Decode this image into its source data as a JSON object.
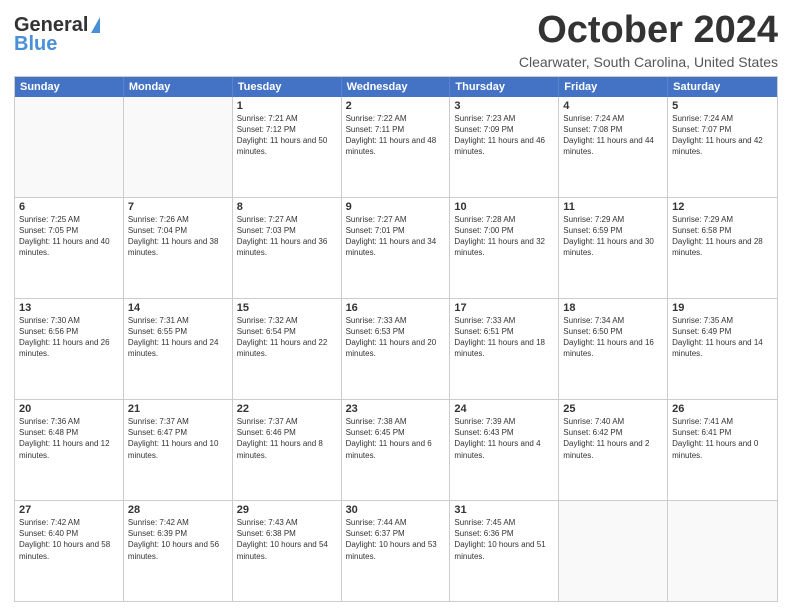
{
  "header": {
    "logo_line1": "General",
    "logo_line2": "Blue",
    "month_title": "October 2024",
    "location": "Clearwater, South Carolina, United States"
  },
  "days_of_week": [
    "Sunday",
    "Monday",
    "Tuesday",
    "Wednesday",
    "Thursday",
    "Friday",
    "Saturday"
  ],
  "weeks": [
    [
      {
        "day": "",
        "empty": true
      },
      {
        "day": "",
        "empty": true
      },
      {
        "day": "1",
        "sunrise": "Sunrise: 7:21 AM",
        "sunset": "Sunset: 7:12 PM",
        "daylight": "Daylight: 11 hours and 50 minutes."
      },
      {
        "day": "2",
        "sunrise": "Sunrise: 7:22 AM",
        "sunset": "Sunset: 7:11 PM",
        "daylight": "Daylight: 11 hours and 48 minutes."
      },
      {
        "day": "3",
        "sunrise": "Sunrise: 7:23 AM",
        "sunset": "Sunset: 7:09 PM",
        "daylight": "Daylight: 11 hours and 46 minutes."
      },
      {
        "day": "4",
        "sunrise": "Sunrise: 7:24 AM",
        "sunset": "Sunset: 7:08 PM",
        "daylight": "Daylight: 11 hours and 44 minutes."
      },
      {
        "day": "5",
        "sunrise": "Sunrise: 7:24 AM",
        "sunset": "Sunset: 7:07 PM",
        "daylight": "Daylight: 11 hours and 42 minutes."
      }
    ],
    [
      {
        "day": "6",
        "sunrise": "Sunrise: 7:25 AM",
        "sunset": "Sunset: 7:05 PM",
        "daylight": "Daylight: 11 hours and 40 minutes."
      },
      {
        "day": "7",
        "sunrise": "Sunrise: 7:26 AM",
        "sunset": "Sunset: 7:04 PM",
        "daylight": "Daylight: 11 hours and 38 minutes."
      },
      {
        "day": "8",
        "sunrise": "Sunrise: 7:27 AM",
        "sunset": "Sunset: 7:03 PM",
        "daylight": "Daylight: 11 hours and 36 minutes."
      },
      {
        "day": "9",
        "sunrise": "Sunrise: 7:27 AM",
        "sunset": "Sunset: 7:01 PM",
        "daylight": "Daylight: 11 hours and 34 minutes."
      },
      {
        "day": "10",
        "sunrise": "Sunrise: 7:28 AM",
        "sunset": "Sunset: 7:00 PM",
        "daylight": "Daylight: 11 hours and 32 minutes."
      },
      {
        "day": "11",
        "sunrise": "Sunrise: 7:29 AM",
        "sunset": "Sunset: 6:59 PM",
        "daylight": "Daylight: 11 hours and 30 minutes."
      },
      {
        "day": "12",
        "sunrise": "Sunrise: 7:29 AM",
        "sunset": "Sunset: 6:58 PM",
        "daylight": "Daylight: 11 hours and 28 minutes."
      }
    ],
    [
      {
        "day": "13",
        "sunrise": "Sunrise: 7:30 AM",
        "sunset": "Sunset: 6:56 PM",
        "daylight": "Daylight: 11 hours and 26 minutes."
      },
      {
        "day": "14",
        "sunrise": "Sunrise: 7:31 AM",
        "sunset": "Sunset: 6:55 PM",
        "daylight": "Daylight: 11 hours and 24 minutes."
      },
      {
        "day": "15",
        "sunrise": "Sunrise: 7:32 AM",
        "sunset": "Sunset: 6:54 PM",
        "daylight": "Daylight: 11 hours and 22 minutes."
      },
      {
        "day": "16",
        "sunrise": "Sunrise: 7:33 AM",
        "sunset": "Sunset: 6:53 PM",
        "daylight": "Daylight: 11 hours and 20 minutes."
      },
      {
        "day": "17",
        "sunrise": "Sunrise: 7:33 AM",
        "sunset": "Sunset: 6:51 PM",
        "daylight": "Daylight: 11 hours and 18 minutes."
      },
      {
        "day": "18",
        "sunrise": "Sunrise: 7:34 AM",
        "sunset": "Sunset: 6:50 PM",
        "daylight": "Daylight: 11 hours and 16 minutes."
      },
      {
        "day": "19",
        "sunrise": "Sunrise: 7:35 AM",
        "sunset": "Sunset: 6:49 PM",
        "daylight": "Daylight: 11 hours and 14 minutes."
      }
    ],
    [
      {
        "day": "20",
        "sunrise": "Sunrise: 7:36 AM",
        "sunset": "Sunset: 6:48 PM",
        "daylight": "Daylight: 11 hours and 12 minutes."
      },
      {
        "day": "21",
        "sunrise": "Sunrise: 7:37 AM",
        "sunset": "Sunset: 6:47 PM",
        "daylight": "Daylight: 11 hours and 10 minutes."
      },
      {
        "day": "22",
        "sunrise": "Sunrise: 7:37 AM",
        "sunset": "Sunset: 6:46 PM",
        "daylight": "Daylight: 11 hours and 8 minutes."
      },
      {
        "day": "23",
        "sunrise": "Sunrise: 7:38 AM",
        "sunset": "Sunset: 6:45 PM",
        "daylight": "Daylight: 11 hours and 6 minutes."
      },
      {
        "day": "24",
        "sunrise": "Sunrise: 7:39 AM",
        "sunset": "Sunset: 6:43 PM",
        "daylight": "Daylight: 11 hours and 4 minutes."
      },
      {
        "day": "25",
        "sunrise": "Sunrise: 7:40 AM",
        "sunset": "Sunset: 6:42 PM",
        "daylight": "Daylight: 11 hours and 2 minutes."
      },
      {
        "day": "26",
        "sunrise": "Sunrise: 7:41 AM",
        "sunset": "Sunset: 6:41 PM",
        "daylight": "Daylight: 11 hours and 0 minutes."
      }
    ],
    [
      {
        "day": "27",
        "sunrise": "Sunrise: 7:42 AM",
        "sunset": "Sunset: 6:40 PM",
        "daylight": "Daylight: 10 hours and 58 minutes."
      },
      {
        "day": "28",
        "sunrise": "Sunrise: 7:42 AM",
        "sunset": "Sunset: 6:39 PM",
        "daylight": "Daylight: 10 hours and 56 minutes."
      },
      {
        "day": "29",
        "sunrise": "Sunrise: 7:43 AM",
        "sunset": "Sunset: 6:38 PM",
        "daylight": "Daylight: 10 hours and 54 minutes."
      },
      {
        "day": "30",
        "sunrise": "Sunrise: 7:44 AM",
        "sunset": "Sunset: 6:37 PM",
        "daylight": "Daylight: 10 hours and 53 minutes."
      },
      {
        "day": "31",
        "sunrise": "Sunrise: 7:45 AM",
        "sunset": "Sunset: 6:36 PM",
        "daylight": "Daylight: 10 hours and 51 minutes."
      },
      {
        "day": "",
        "empty": true
      },
      {
        "day": "",
        "empty": true
      }
    ]
  ]
}
